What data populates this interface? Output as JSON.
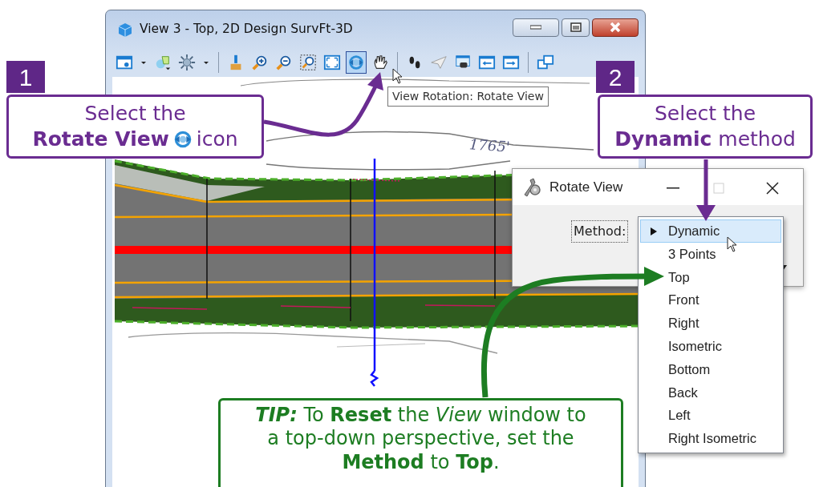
{
  "view_window": {
    "title": "View 3 - Top, 2D Design SurvFt-3D",
    "toolbar": [
      {
        "kind": "view-attributes",
        "selected": false
      },
      {
        "kind": "caret",
        "selected": false
      },
      {
        "kind": "display-style",
        "selected": false
      },
      {
        "kind": "sun",
        "selected": false
      },
      {
        "kind": "caret",
        "selected": false
      },
      {
        "kind": "separator"
      },
      {
        "kind": "brush",
        "selected": false
      },
      {
        "kind": "zoom-in",
        "selected": false
      },
      {
        "kind": "zoom-out",
        "selected": false
      },
      {
        "kind": "window-area",
        "selected": false
      },
      {
        "kind": "fit",
        "selected": false
      },
      {
        "kind": "rotate",
        "selected": true
      },
      {
        "kind": "pan",
        "selected": false
      },
      {
        "kind": "separator"
      },
      {
        "kind": "walk",
        "selected": false
      },
      {
        "kind": "fly",
        "selected": false
      },
      {
        "kind": "camera",
        "selected": false
      },
      {
        "kind": "previous",
        "selected": false
      },
      {
        "kind": "next",
        "selected": false
      },
      {
        "kind": "separator"
      },
      {
        "kind": "copy-view",
        "selected": false
      }
    ],
    "tooltip": "View Rotation: Rotate View",
    "annotation": "1765'"
  },
  "steps": [
    {
      "number": "1",
      "line_1": "Select the",
      "line_2": [
        {
          "kind": "text",
          "text": "**Rotate View**"
        },
        {
          "kind": "icon"
        },
        {
          "kind": "text",
          "text": "icon"
        }
      ]
    },
    {
      "number": "2",
      "line_1": "Select the",
      "line_2": [
        {
          "kind": "text",
          "text": "**Dynamic** method"
        }
      ]
    }
  ],
  "dialog": {
    "title": "Rotate View",
    "method_label": "Method:",
    "options": [
      {
        "label": "Dynamic",
        "selected": true
      },
      {
        "label": "3 Points",
        "selected": false
      },
      {
        "label": "Top",
        "selected": false
      },
      {
        "label": "Front",
        "selected": false
      },
      {
        "label": "Right",
        "selected": false
      },
      {
        "label": "Isometric",
        "selected": false
      },
      {
        "label": "Bottom",
        "selected": false
      },
      {
        "label": "Back",
        "selected": false
      },
      {
        "label": "Left",
        "selected": false
      },
      {
        "label": "Right Isometric",
        "selected": false
      }
    ]
  },
  "tip": {
    "text": "**TIP:** To **Reset** the *View* window to a top-down perspective, set the **Method** to **Top**."
  }
}
